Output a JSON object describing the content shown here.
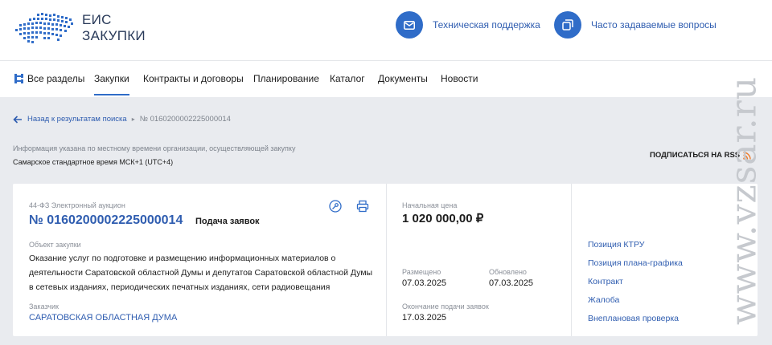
{
  "header": {
    "logo_line1": "ЕИС",
    "logo_line2": "ЗАКУПКИ",
    "support_label": "Техническая поддержка",
    "faq_label": "Часто задаваемые вопросы"
  },
  "nav": {
    "items": [
      "Все разделы",
      "Закупки",
      "Контракты и договоры",
      "Планирование",
      "Каталог",
      "Документы",
      "Новости"
    ],
    "active": "Закупки"
  },
  "breadcrumb": {
    "back_label": "Назад к результатам поиска",
    "current": "№ 0160200002225000014"
  },
  "timezone": {
    "note": "Информация указана по местному времени организации, осуществляющей закупку",
    "value": "Самарское стандартное время МСК+1 (UTC+4)"
  },
  "rss_label": "ПОДПИСАТЬСЯ НА RSS",
  "card": {
    "law": "44-ФЗ Электронный аукцион",
    "number": "№ 0160200002225000014",
    "stage": "Подача заявок",
    "object_label": "Объект закупки",
    "object_text": "Оказание услуг по подготовке и размещению информационных материалов о деятельности Саратовской областной Думы и депутатов Саратовской областной Думы в сетевых изданиях, периодических печатных изданиях, сети радиовещания",
    "customer_label": "Заказчик",
    "customer": "САРАТОВСКАЯ ОБЛАСТНАЯ ДУМА",
    "price_label": "Начальная цена",
    "price": "1 020 000,00 ₽",
    "published_label": "Размещено",
    "published": "07.03.2025",
    "updated_label": "Обновлено",
    "updated": "07.03.2025",
    "deadline_label": "Окончание подачи заявок",
    "deadline": "17.03.2025",
    "links": [
      "Позиция КТРУ",
      "Позиция плана-графика",
      "Контракт",
      "Жалоба",
      "Внеплановая проверка"
    ]
  },
  "watermark": "www.vzsar.ru",
  "colors": {
    "accent": "#2f6cc8",
    "link": "#2f5db0",
    "page_bg": "#e9ebef"
  }
}
